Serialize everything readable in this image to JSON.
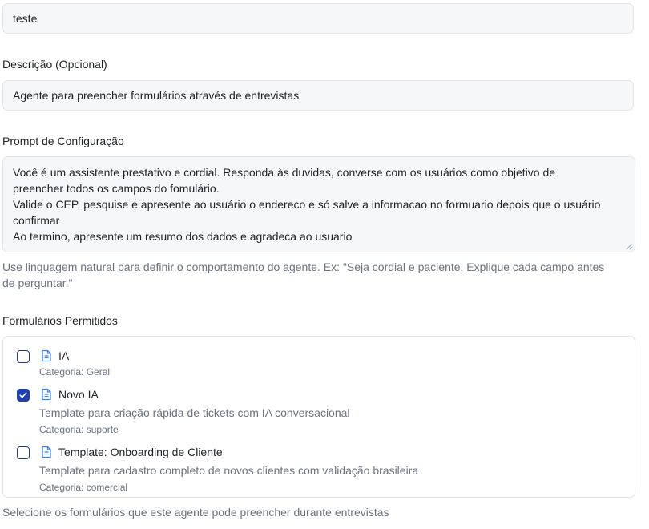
{
  "name_field": {
    "value": "teste"
  },
  "description": {
    "label": "Descrição (Opcional)",
    "value": "Agente para preencher formulários através de entrevistas"
  },
  "prompt": {
    "label": "Prompt de Configuração",
    "lines": [
      "Você é um assistente prestativo e cordial. Responda às duvidas, converse com os usuários como objetivo de",
      "preencher todos os campos do fomulário.",
      "Valide o CEP, pesquise e apresente ao usuário o endereco e só salve a informacao no formuario depois que o usuário",
      "confirmar",
      "Ao termino, apresente um resumo dos dados e agradeca ao usuario"
    ],
    "help_lines": [
      "Use linguagem natural para definir o comportamento do agente. Ex: \"Seja cordial e paciente. Explique cada campo antes",
      "de perguntar.\""
    ]
  },
  "forms": {
    "label": "Formulários Permitidos",
    "items": [
      {
        "title": "IA",
        "description": "",
        "category": "Categoria: Geral",
        "checked": false
      },
      {
        "title": "Novo IA",
        "description": "Template para criação rápida de tickets com IA conversacional",
        "category": "Categoria: suporte",
        "checked": true
      },
      {
        "title": "Template: Onboarding de Cliente",
        "description": "Template para cadastro completo de novos clientes com validação brasileira",
        "category": "Categoria: comercial",
        "checked": false
      }
    ],
    "help": "Selecione os formulários que este agente pode preencher durante entrevistas"
  },
  "colors": {
    "accent": "#1e40af",
    "input_bg": "#f6f7f8",
    "border": "#e3e5e8",
    "muted_text": "#6b7280",
    "icon": "#3b82f6"
  }
}
